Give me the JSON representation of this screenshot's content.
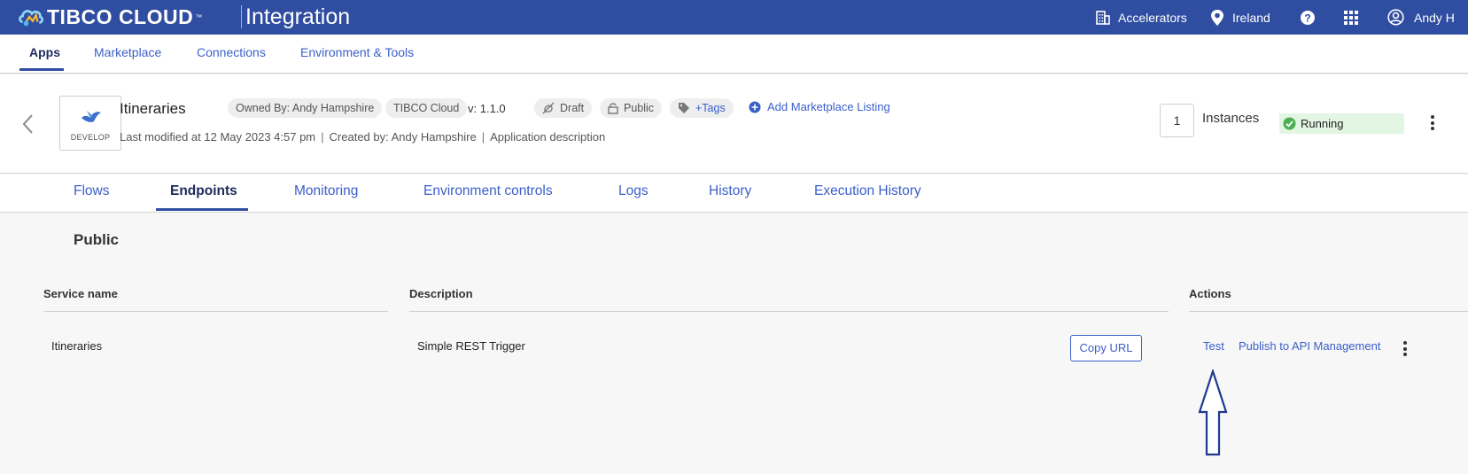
{
  "header": {
    "brand": "TIBCO CLOUD",
    "brand_tm": "™",
    "product": "Integration",
    "accelerators_label": "Accelerators",
    "region_label": "Ireland",
    "user_label": "Andy H"
  },
  "nav": {
    "items": [
      {
        "label": "Apps",
        "active": true
      },
      {
        "label": "Marketplace"
      },
      {
        "label": "Connections"
      },
      {
        "label": "Environment & Tools"
      }
    ]
  },
  "app": {
    "name": "Itineraries",
    "badge": "DEVELOP",
    "owned_by": "Owned By:  Andy Hampshire",
    "cloud": "TIBCO Cloud",
    "version": "v: 1.1.0",
    "draft": "Draft",
    "visibility": "Public",
    "tags": "+Tags",
    "add_listing": "Add Marketplace Listing",
    "last_modified": "Last modified at 12 May 2023 4:57 pm",
    "created_by": "Created by: Andy Hampshire",
    "description": "Application description",
    "instances_count": "1",
    "instances_label": "Instances",
    "status": "Running"
  },
  "tabs": [
    {
      "label": "Flows"
    },
    {
      "label": "Endpoints",
      "active": true
    },
    {
      "label": "Monitoring"
    },
    {
      "label": "Environment controls"
    },
    {
      "label": "Logs"
    },
    {
      "label": "History"
    },
    {
      "label": "Execution History"
    }
  ],
  "endpoints": {
    "section_title": "Public",
    "columns": {
      "service_name": "Service name",
      "description": "Description",
      "actions": "Actions"
    },
    "rows": [
      {
        "service_name": "Itineraries",
        "description": "Simple REST Trigger",
        "copy_url": "Copy URL",
        "test": "Test",
        "publish": "Publish to API Management"
      }
    ]
  },
  "colors": {
    "brand_blue": "#2f4da1",
    "link_blue": "#3b5fc9",
    "running_bg": "#e3f5e3",
    "running_icon": "#4caf50"
  }
}
